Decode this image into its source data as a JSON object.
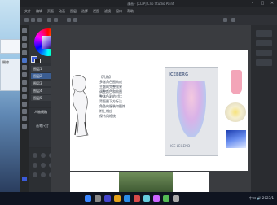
{
  "desktop": {
    "window_labels": [
      "",
      "開啓"
    ]
  },
  "window": {
    "title": "漫画 · [CLIP] Clip Studio Paint",
    "controls": [
      "–",
      "□",
      "✕"
    ]
  },
  "menu": [
    "文件",
    "编辑",
    "页面",
    "动画",
    "图层",
    "选择",
    "视图",
    "滤镜",
    "窗口",
    "帮助"
  ],
  "layers": [
    "图层1",
    "图层2",
    "图层3",
    "图层4",
    "图层5"
  ],
  "subpanel": {
    "label": "人物线稿",
    "sub": "画笔尺寸"
  },
  "notes": {
    "lines": [
      "【几稿】",
      "",
      "多张角色图构成",
      "主题的完整效果",
      "",
      "调整颜色和构图",
      "整体色彩的对比",
      "",
      "背面图下方标注",
      "角色的服装和配饰",
      "附上相应",
      "保持风格统一"
    ]
  },
  "poster": {
    "title": "ICEBERG",
    "footer": "ICE LEGEND"
  },
  "taskbar": {
    "tray_text": "中  ✉  🔊  2023/1"
  },
  "colors": {
    "accent": "#4a74c9",
    "page": "#ffffff"
  }
}
